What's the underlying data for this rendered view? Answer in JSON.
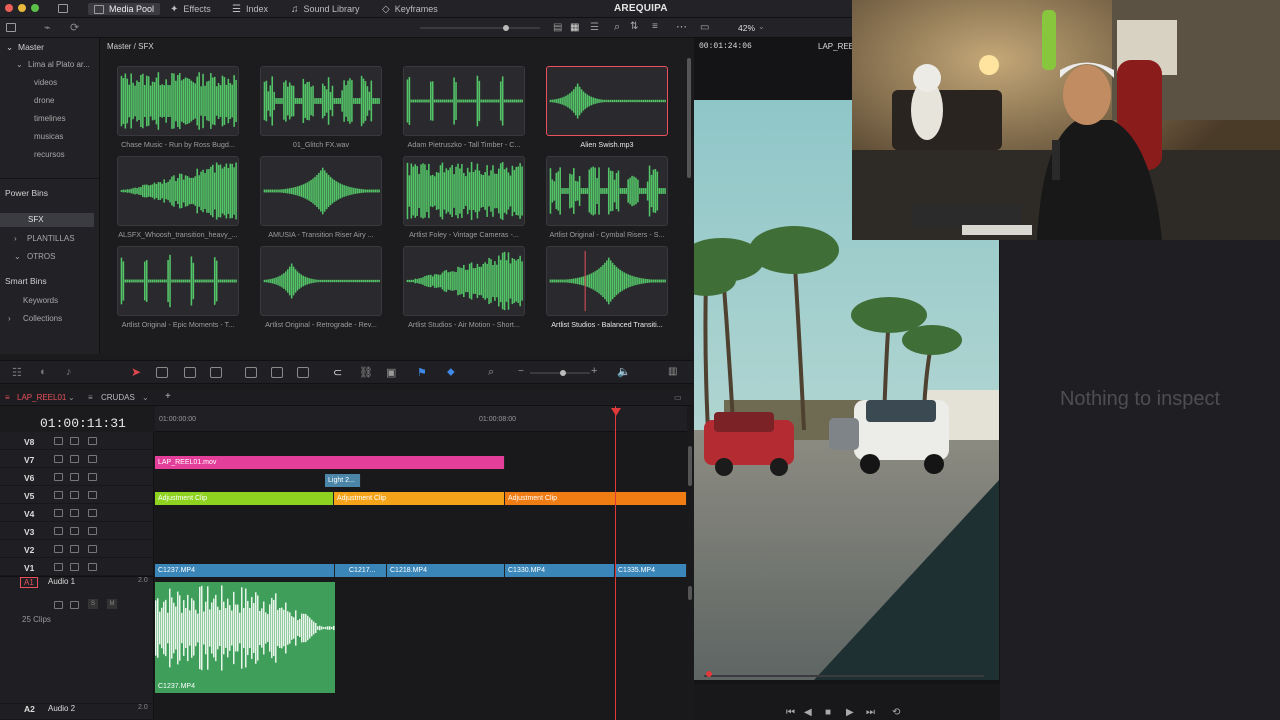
{
  "topbar": {
    "tabs": [
      "Media Pool",
      "Effects",
      "Index",
      "Sound Library",
      "Keyframes"
    ],
    "project_title": "AREQUIPA",
    "zoom": "42%",
    "viewer_timecode": "00:01:24:06",
    "viewer_clipname": "LAP_REEL"
  },
  "sidebar": {
    "master": "Master",
    "project_folder": "Lima al Plato ar...",
    "items": [
      "videos",
      "drone",
      "timelines",
      "musicas",
      "recursos"
    ],
    "power_bins_label": "Power Bins",
    "power_bins": [
      "SFX",
      "PLANTILLAS",
      "OTROS"
    ],
    "smart_bins_label": "Smart Bins",
    "smart_bins": [
      "Keywords",
      "Collections"
    ]
  },
  "pool": {
    "breadcrumb": "Master / SFX",
    "clips": [
      {
        "label": "Chase Music - Run by Ross Bugd..."
      },
      {
        "label": "01_Glitch FX.wav"
      },
      {
        "label": "Adam Pietruszko - Tall Timber - C..."
      },
      {
        "label": "Alien Swish.mp3"
      },
      {
        "label": "ALSFX_Whoosh_transition_heavy_..."
      },
      {
        "label": "AMUSIA - Transition Riser Airy ..."
      },
      {
        "label": "Artlist Foley - Vintage Cameras -..."
      },
      {
        "label": "Artlist Original - Cymbal Risers - S..."
      },
      {
        "label": "Artlist Original - Epic Moments - T..."
      },
      {
        "label": "Artlist Original - Retrograde - Rev..."
      },
      {
        "label": "Artlist Studios - Air Motion - Short..."
      },
      {
        "label": "Artlist Studios - Balanced Transiti..."
      }
    ]
  },
  "timeline": {
    "tabs": [
      "LAP_REEL01",
      "CRUDAS"
    ],
    "timecode": "01:00:11:31",
    "ruler": [
      "01:00:00:00",
      "01:00:08:00"
    ],
    "video_tracks": [
      "V8",
      "V7",
      "V6",
      "V5",
      "V4",
      "V3",
      "V2",
      "V1"
    ],
    "audio_tracks": [
      {
        "id": "A1",
        "name": "Audio 1",
        "level": "2.0",
        "clip_count": "25 Clips"
      },
      {
        "id": "A2",
        "name": "Audio 2",
        "level": "2.0"
      }
    ],
    "clips": {
      "v7": "LAP_REEL01.mov",
      "v6": "Light 2...",
      "v5": [
        "Adjustment Clip",
        "Adjustment Clip",
        "Adjustment Clip"
      ],
      "v1": [
        "C1237.MP4",
        "C1217...",
        "C1218.MP4",
        "C1330.MP4",
        "C1335.MP4"
      ],
      "a1": "C1237.MP4"
    },
    "track_solo": "S",
    "track_mute": "M"
  },
  "inspector": {
    "empty_message": "Nothing to inspect"
  },
  "colors": {
    "accent_red": "#e8505b",
    "v7_clip": "#e33f9a",
    "v6_clip": "#4b86a8",
    "adj_green": "#8ed31f",
    "adj_orange": "#f5a41a",
    "adj_dark_orange": "#ef7d13",
    "v1_clip": "#3a86b8",
    "audio_clip": "#3e9e5a",
    "waveform_green": "#54c468"
  },
  "icons": [
    "media-pool-icon",
    "effects-icon",
    "index-icon",
    "sound-library-icon",
    "keyframes-icon",
    "search-icon",
    "grid-view-icon",
    "list-view-icon",
    "sort-icon",
    "more-icon",
    "selection-arrow-icon",
    "razor-icon",
    "link-icon",
    "lock-icon",
    "flag-icon",
    "marker-icon",
    "zoom-icon",
    "speaker-icon",
    "play-icon",
    "stop-icon",
    "prev-icon",
    "next-icon",
    "loop-icon"
  ]
}
